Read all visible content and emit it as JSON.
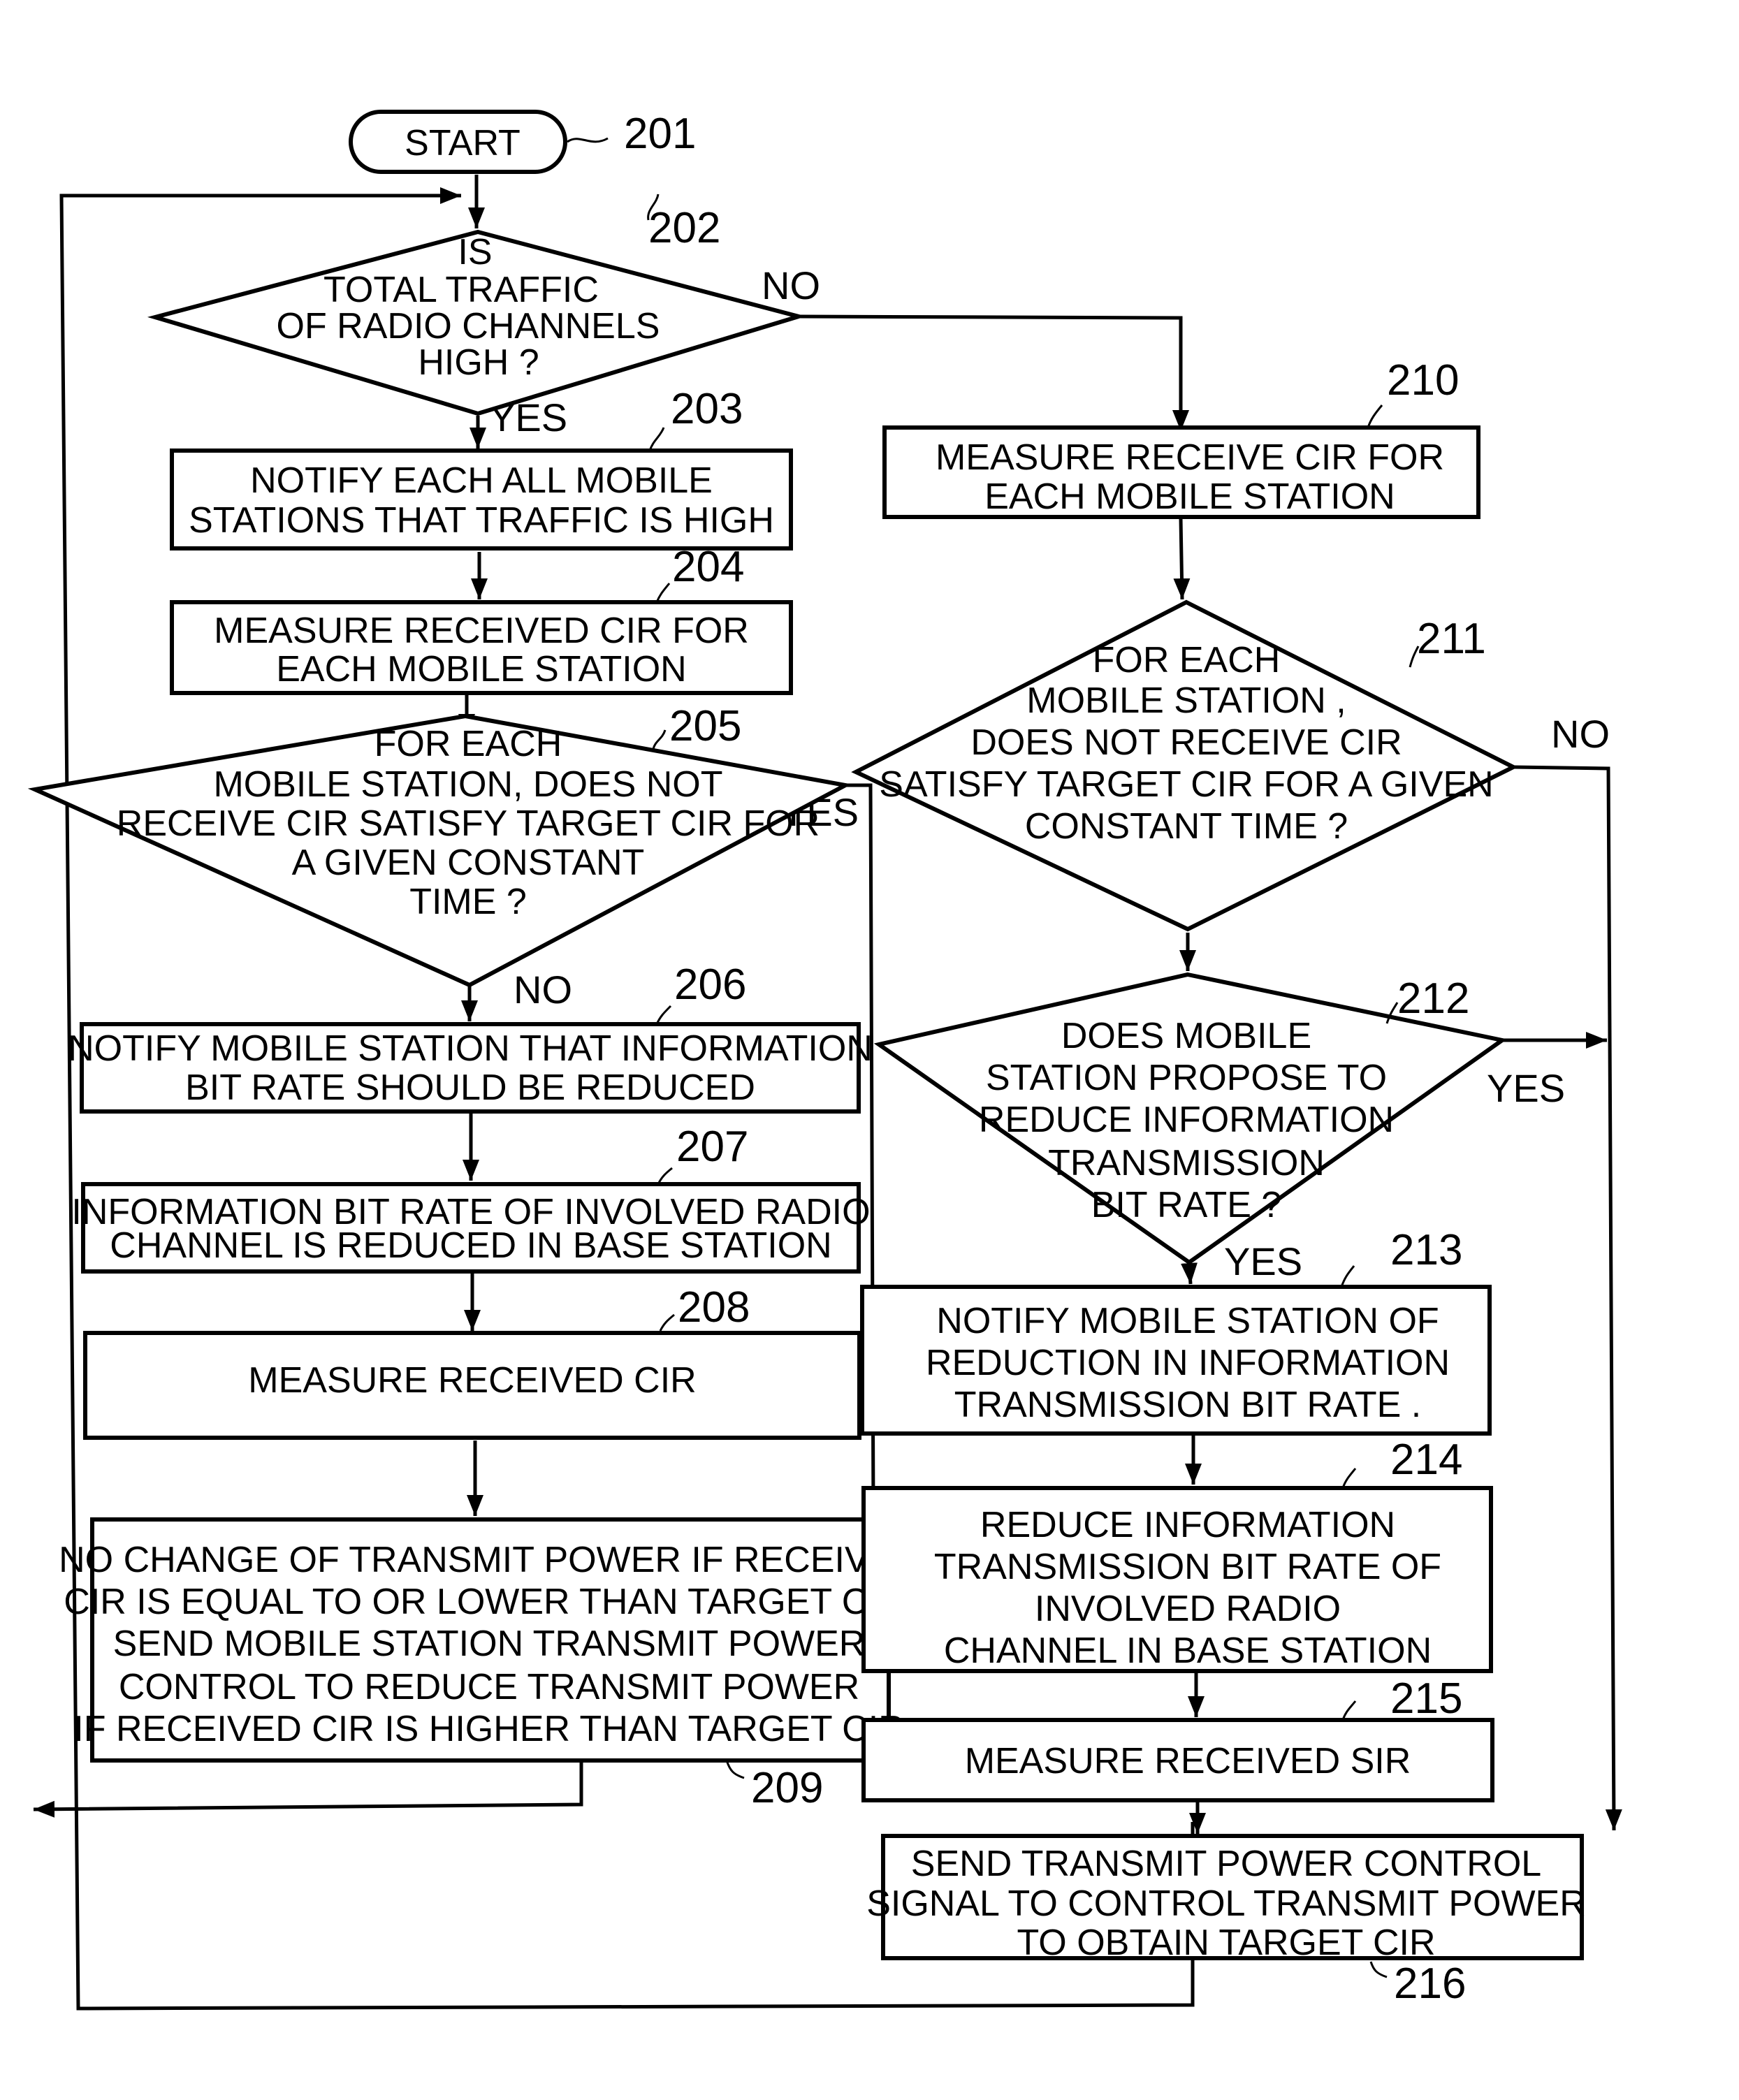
{
  "figure": {
    "colors": {
      "ink": "#000000",
      "paper": "#ffffff"
    },
    "nodes": [
      {
        "id": "201",
        "type": "terminal",
        "ref": "201",
        "lines": [
          "START"
        ]
      },
      {
        "id": "202",
        "type": "decision",
        "ref": "202",
        "lines": [
          "IS",
          "TOTAL  TRAFFIC",
          "OF  RADIO  CHANNELS",
          "HIGH ?"
        ]
      },
      {
        "id": "203",
        "type": "process",
        "ref": "203",
        "lines": [
          "NOTIFY EACH ALL MOBILE",
          "STATIONS THAT TRAFFIC IS HIGH"
        ]
      },
      {
        "id": "204",
        "type": "process",
        "ref": "204",
        "lines": [
          "MEASURE RECEIVED CIR FOR",
          "EACH MOBILE STATION"
        ]
      },
      {
        "id": "205",
        "type": "decision",
        "ref": "205",
        "lines": [
          "FOR EACH",
          "MOBILE STATION, DOES NOT",
          "RECEIVE CIR SATISFY TARGET CIR FOR",
          "A GIVEN CONSTANT",
          "TIME ?"
        ]
      },
      {
        "id": "206",
        "type": "process",
        "ref": "206",
        "lines": [
          "NOTIFY MOBILE STATION THAT INFORMATION",
          "BIT RATE SHOULD BE REDUCED"
        ]
      },
      {
        "id": "207",
        "type": "process",
        "ref": "207",
        "lines": [
          "INFORMATION BIT RATE OF INVOLVED RADIO",
          "CHANNEL IS REDUCED IN BASE STATION"
        ]
      },
      {
        "id": "208",
        "type": "process",
        "ref": "208",
        "lines": [
          "MEASURE RECEIVED CIR"
        ]
      },
      {
        "id": "209",
        "type": "process",
        "ref": "209",
        "lines": [
          "NO CHANGE OF TRANSMIT POWER IF RECEIVED",
          "CIR IS EQUAL TO OR LOWER THAN TARGET CIR;",
          "SEND MOBILE STATION TRANSMIT POWER",
          "CONTROL TO REDUCE TRANSMIT POWER",
          "IF RECEIVED CIR IS HIGHER THAN TARGET CIR"
        ]
      },
      {
        "id": "210",
        "type": "process",
        "ref": "210",
        "lines": [
          "MEASURE RECEIVE CIR FOR",
          "EACH MOBILE STATION"
        ]
      },
      {
        "id": "211",
        "type": "decision",
        "ref": "211",
        "lines": [
          "FOR EACH",
          "MOBILE STATION ,",
          "DOES NOT RECEIVE CIR",
          "SATISFY TARGET CIR FOR A GIVEN",
          "CONSTANT TIME ?"
        ]
      },
      {
        "id": "212",
        "type": "decision",
        "ref": "212",
        "lines": [
          "DOES MOBILE",
          "STATION PROPOSE TO",
          "REDUCE INFORMATION",
          "TRANSMISSION",
          "BIT RATE ?"
        ]
      },
      {
        "id": "213",
        "type": "process",
        "ref": "213",
        "lines": [
          "NOTIFY MOBILE STATION OF",
          "REDUCTION IN INFORMATION",
          "TRANSMISSION BIT RATE ."
        ]
      },
      {
        "id": "214",
        "type": "process",
        "ref": "214",
        "lines": [
          "REDUCE INFORMATION",
          "TRANSMISSION BIT RATE OF",
          "INVOLVED RADIO",
          "CHANNEL IN BASE STATION"
        ]
      },
      {
        "id": "215",
        "type": "process",
        "ref": "215",
        "lines": [
          "MEASURE RECEIVED SIR"
        ]
      },
      {
        "id": "216",
        "type": "process",
        "ref": "216",
        "lines": [
          "SEND TRANSMIT POWER CONTROL",
          "SIGNAL TO CONTROL TRANSMIT POWER",
          "TO OBTAIN TARGET CIR"
        ]
      }
    ],
    "edges": [
      {
        "from": "201",
        "to": "202",
        "label": ""
      },
      {
        "from": "202",
        "to": "203",
        "label": "YES"
      },
      {
        "from": "202",
        "to": "210",
        "label": "NO"
      },
      {
        "from": "203",
        "to": "204",
        "label": ""
      },
      {
        "from": "204",
        "to": "205",
        "label": ""
      },
      {
        "from": "205",
        "to": "206",
        "label": "NO"
      },
      {
        "from": "205",
        "to": "209",
        "label": "YES"
      },
      {
        "from": "206",
        "to": "207",
        "label": ""
      },
      {
        "from": "207",
        "to": "208",
        "label": ""
      },
      {
        "from": "208",
        "to": "209",
        "label": ""
      },
      {
        "from": "209",
        "to": "202",
        "label": ""
      },
      {
        "from": "210",
        "to": "211",
        "label": ""
      },
      {
        "from": "211",
        "to": "212",
        "label": "NO"
      },
      {
        "from": "211",
        "to": "216",
        "label": "YES"
      },
      {
        "from": "212",
        "to": "213",
        "label": "YES"
      },
      {
        "from": "212",
        "to": "216",
        "label": "NO"
      },
      {
        "from": "213",
        "to": "214",
        "label": ""
      },
      {
        "from": "214",
        "to": "215",
        "label": ""
      },
      {
        "from": "215",
        "to": "216",
        "label": ""
      },
      {
        "from": "216",
        "to": "202",
        "label": ""
      }
    ]
  }
}
